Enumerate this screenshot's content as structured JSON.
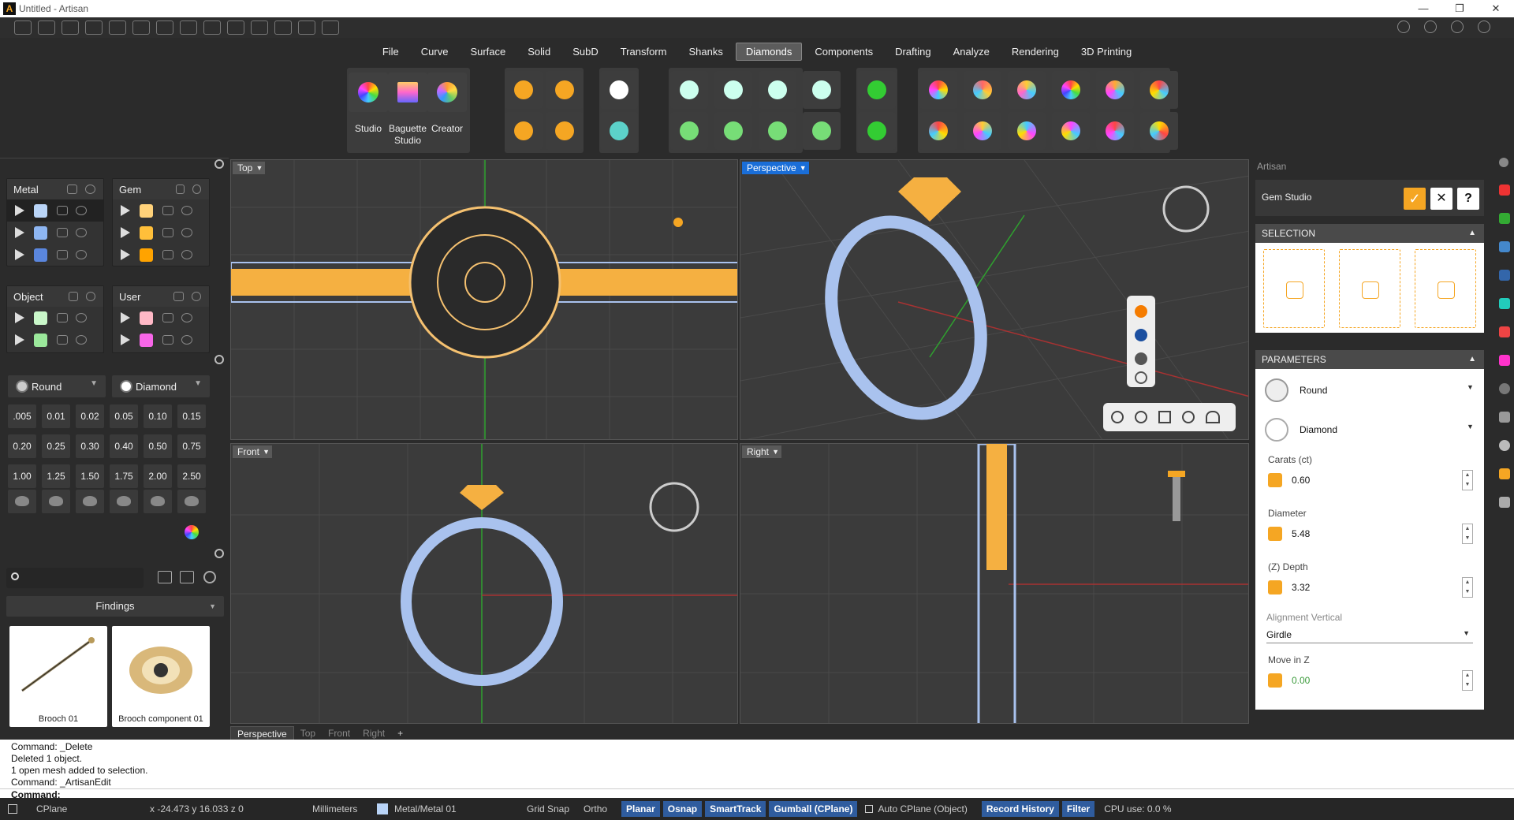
{
  "window": {
    "title": "Untitled - Artisan",
    "controls": [
      "—",
      "❐",
      "✕"
    ]
  },
  "menu": {
    "tabs": [
      "File",
      "Curve",
      "Surface",
      "Solid",
      "SubD",
      "Transform",
      "Shanks",
      "Diamonds",
      "Components",
      "Drafting",
      "Analyze",
      "Rendering",
      "3D Printing"
    ],
    "active": "Diamonds"
  },
  "ribbon": {
    "labels": {
      "studio": "Studio",
      "baguette": "Baguette Studio",
      "creator": "Creator"
    }
  },
  "layers": {
    "metal": "Metal",
    "gem": "Gem",
    "object": "Object",
    "user": "User",
    "colors": {
      "metal": [
        "#b9d4f7",
        "#8eb6f2",
        "#5a86de"
      ],
      "gem": [
        "#ffd27a",
        "#ffbf3a",
        "#ffa300"
      ],
      "object": [
        "#c9f7c9",
        "#9be89b"
      ],
      "user": [
        "#ffb8c6",
        "#f766e8"
      ]
    }
  },
  "gemselect": {
    "shape": "Round",
    "material": "Diamond"
  },
  "carats": [
    ".005",
    "0.01",
    "0.02",
    "0.05",
    "0.10",
    "0.15",
    "0.20",
    "0.25",
    "0.30",
    "0.40",
    "0.50",
    "0.75",
    "1.00",
    "1.25",
    "1.50",
    "1.75",
    "2.00",
    "2.50"
  ],
  "library": {
    "category": "Findings",
    "items": [
      "Brooch 01",
      "Brooch component 01"
    ]
  },
  "viewports": {
    "top": "Top",
    "perspective": "Perspective",
    "front": "Front",
    "right": "Right"
  },
  "viewport_tabs": [
    "Perspective",
    "Top",
    "Front",
    "Right",
    "+"
  ],
  "artisan": {
    "panel_title": "Artisan",
    "studio_title": "Gem Studio",
    "selection_header": "SELECTION",
    "parameters_header": "PARAMETERS",
    "shape": "Round",
    "material": "Diamond",
    "carats_label": "Carats (ct)",
    "carats_value": "0.60",
    "diameter_label": "Diameter",
    "diameter_value": "5.48",
    "depth_label": "(Z) Depth",
    "depth_value": "3.32",
    "alignment_label": "Alignment Vertical",
    "alignment_value": "Girdle",
    "movez_label": "Move in Z",
    "movez_value": "0.00"
  },
  "command_history": [
    "Command: _Delete",
    "Deleted 1 object.",
    "1 open mesh added to selection.",
    "Command: _ArtisanEdit"
  ],
  "command_prompt": "Command:",
  "status": {
    "cplane": "CPlane",
    "coords": "x -24.473  y 16.033  z 0",
    "units": "Millimeters",
    "layer": "Metal/Metal 01",
    "grid_snap": "Grid Snap",
    "ortho": "Ortho",
    "planar": "Planar",
    "osnap": "Osnap",
    "smarttrack": "SmartTrack",
    "gumball": "Gumball (CPlane)",
    "autocplane": "Auto CPlane (Object)",
    "record_history": "Record History",
    "filter": "Filter",
    "cpu": "CPU use: 0.0 %"
  }
}
